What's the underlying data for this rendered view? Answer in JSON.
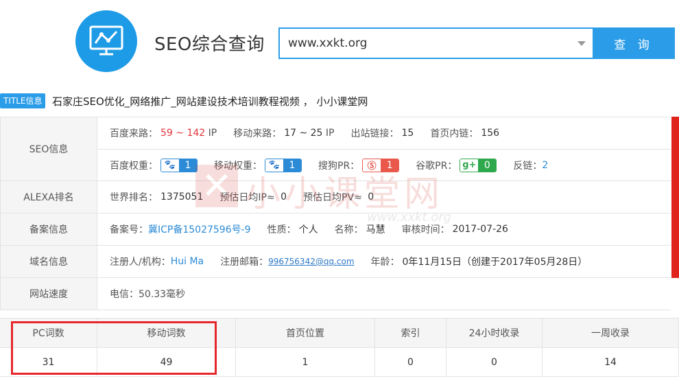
{
  "header": {
    "app_title": "SEO综合查询",
    "search_value": "www.xxkt.org",
    "search_button": "查 询"
  },
  "title_row": {
    "badge": "TITLE信息",
    "text": "石家庄SEO优化_网络推广_网站建设技术培训教程视频 ， 小小课堂网"
  },
  "seo": {
    "label": "SEO信息",
    "baidu_traffic_label": "百度来路：",
    "baidu_traffic_value": "59 ~ 142",
    "baidu_traffic_unit": "IP",
    "mobile_traffic_label": "移动来路：",
    "mobile_traffic_value": "17 ~ 25",
    "mobile_traffic_unit": "IP",
    "outbound_label": "出站链接：",
    "outbound_value": "15",
    "internal_label": "首页内链：",
    "internal_value": "156",
    "baidu_weight_label": "百度权重：",
    "baidu_weight_value": "1",
    "mobile_weight_label": "移动权重：",
    "mobile_weight_value": "1",
    "sogou_pr_label": "搜狗PR：",
    "sogou_pr_value": "1",
    "google_pr_label": "谷歌PR：",
    "google_pr_value": "0",
    "backlinks_label": "反链：",
    "backlinks_value": "2"
  },
  "alexa": {
    "label": "ALEXA排名",
    "world_rank_label": "世界排名：",
    "world_rank_value": "1375051",
    "daily_ip_label": "预估日均IP≈",
    "daily_ip_value": "0",
    "daily_pv_label": "预估日均PV≈",
    "daily_pv_value": "0"
  },
  "icp": {
    "label": "备案信息",
    "number_label": "备案号：",
    "number_value": "冀ICP备15027596号-9",
    "nature_label": "性质：",
    "nature_value": "个人",
    "name_label": "名称：",
    "name_value": "马慧",
    "audit_label": "审核时间：",
    "audit_value": "2017-07-26"
  },
  "domain": {
    "label": "域名信息",
    "registrant_label": "注册人/机构：",
    "registrant_value": "Hui Ma",
    "email_label": "注册邮箱：",
    "email_value": "996756342@qq.com",
    "age_label": "年龄：",
    "age_value": "0年11月15日（创建于2017年05月28日）"
  },
  "speed": {
    "label": "网站速度",
    "value": "电信：50.33毫秒"
  },
  "watermark": {
    "text": "小小课堂网",
    "url": "www.xxkt.org"
  },
  "stats": {
    "headers": [
      "PC词数",
      "移动词数",
      "首页位置",
      "索引",
      "24小时收录",
      "一周收录"
    ],
    "values": [
      "31",
      "49",
      "1",
      "0",
      "0",
      "14"
    ]
  },
  "colors": {
    "accent": "#2b9de8",
    "red": "#e3343c",
    "highlight": "#e5262b"
  }
}
